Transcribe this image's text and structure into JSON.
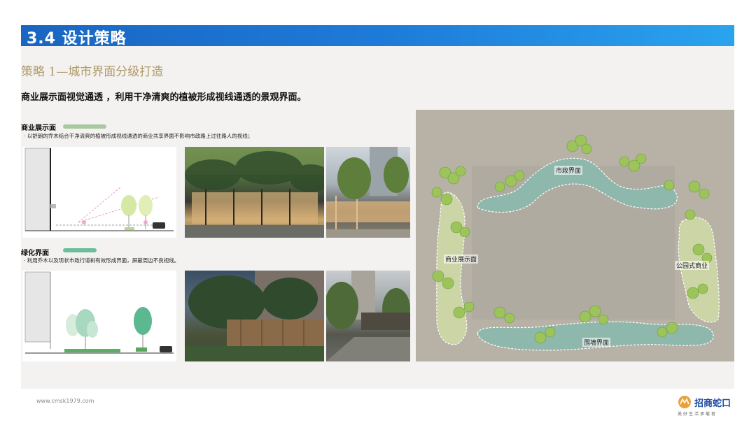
{
  "header": {
    "title": "3.4 设计策略"
  },
  "strategy_title": "策略 1—城市界面分级打造",
  "description": "商业展示面视觉通透 ，利用干净清爽的植被形成视线通透的景观界面。",
  "section_commercial": {
    "label": "商业展示面",
    "note": "· 以舒朗的乔木结合干净清爽的植被形成视线通透的商业共享界面不影响市政路上过往路人的视线；",
    "swatch_color": "#a9c9a0"
  },
  "section_green": {
    "label": "绿化界面",
    "note": "· 利用乔木以及现状市政行道树有效形成界面，屏蔽周边不良视线。",
    "swatch_color": "#6cbf9c"
  },
  "plan": {
    "labels": {
      "municipal": "市政界面",
      "commercial": "商业展示面",
      "park_commercial": "公园式商业",
      "wall": "围墙界面"
    }
  },
  "footer": {
    "url": "www.cmsk1979.com"
  },
  "logo": {
    "name": "招商蛇口",
    "slogan": "美好生活承载者"
  }
}
